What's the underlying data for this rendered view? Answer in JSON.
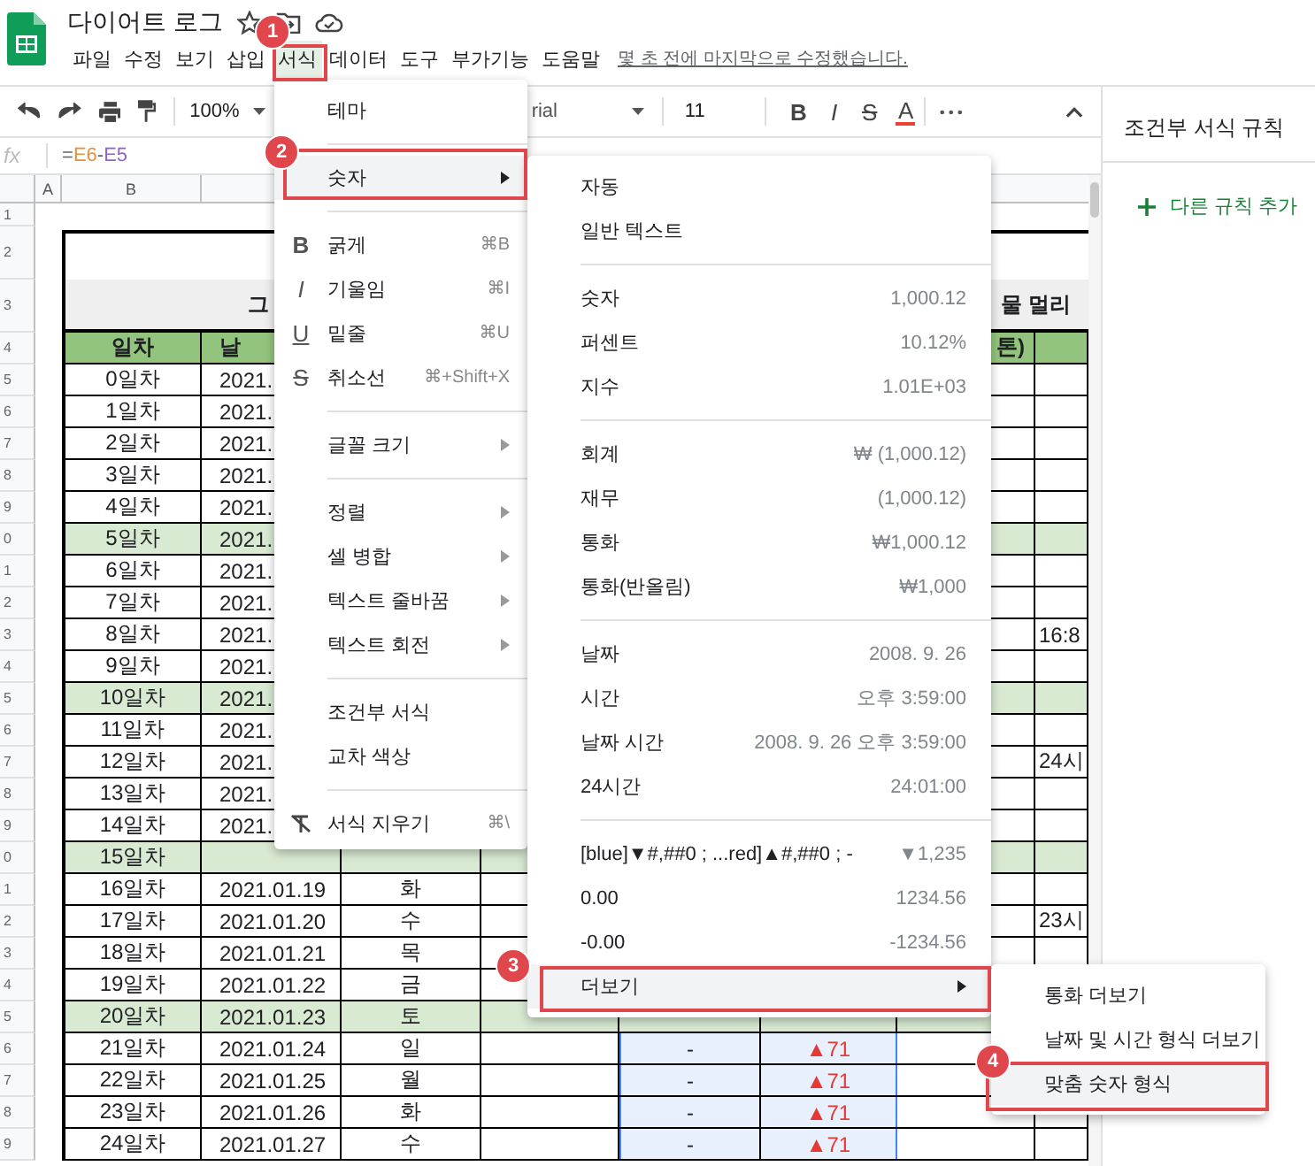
{
  "app": {
    "title": "다이어트 로그",
    "last_edit": "몇 초 전에 마지막으로 수정했습니다."
  },
  "menus": [
    {
      "label": "파일",
      "selected": false
    },
    {
      "label": "수정",
      "selected": false
    },
    {
      "label": "보기",
      "selected": false
    },
    {
      "label": "삽입",
      "selected": false
    },
    {
      "label": "서식",
      "selected": true
    },
    {
      "label": "데이터",
      "selected": false
    },
    {
      "label": "도구",
      "selected": false
    },
    {
      "label": "부가기능",
      "selected": false
    },
    {
      "label": "도움말",
      "selected": false
    }
  ],
  "toolbar": {
    "zoom": "100%",
    "font": "rial",
    "font_size": "11",
    "format_buttons": [
      {
        "glyph": "B",
        "kind": "bold"
      },
      {
        "glyph": "I",
        "kind": "italic"
      },
      {
        "glyph": "S",
        "kind": "strikethrough"
      },
      {
        "glyph": "A",
        "kind": "text-color"
      }
    ]
  },
  "formula_bar": {
    "fx": "fx",
    "parts": [
      {
        "text": "=",
        "color": "#5f6368"
      },
      {
        "text": "E6",
        "color": "#e69138"
      },
      {
        "text": "-",
        "color": "#5f6368"
      },
      {
        "text": "E5",
        "color": "#8e63ce"
      }
    ]
  },
  "columns": [
    "A",
    "B"
  ],
  "sheet": {
    "rows": [
      {
        "num": "1",
        "kind": "blank"
      },
      {
        "num": "2",
        "kind": "top"
      },
      {
        "num": "3",
        "kind": "title",
        "title_left": "그",
        "title_right": "물 멀리"
      },
      {
        "num": "4",
        "kind": "header",
        "day": "일차",
        "date": "날",
        "column_h": "톤)"
      },
      {
        "num": "5",
        "kind": "data",
        "highlighted": false,
        "day": "0일차",
        "date": "2021."
      },
      {
        "num": "6",
        "kind": "data",
        "highlighted": false,
        "day": "1일차",
        "date": "2021."
      },
      {
        "num": "7",
        "kind": "data",
        "highlighted": false,
        "day": "2일차",
        "date": "2021."
      },
      {
        "num": "8",
        "kind": "data",
        "highlighted": false,
        "day": "3일차",
        "date": "2021."
      },
      {
        "num": "9",
        "kind": "data",
        "highlighted": false,
        "day": "4일차",
        "date": "2021."
      },
      {
        "num": "0",
        "kind": "data",
        "highlighted": true,
        "day": "5일차",
        "date": "2021."
      },
      {
        "num": "1",
        "kind": "data",
        "highlighted": false,
        "day": "6일차",
        "date": "2021."
      },
      {
        "num": "2",
        "kind": "data",
        "highlighted": false,
        "day": "7일차",
        "date": "2021."
      },
      {
        "num": "3",
        "kind": "data",
        "highlighted": false,
        "day": "8일차",
        "date": "2021.",
        "column_i": "16:8"
      },
      {
        "num": "4",
        "kind": "data",
        "highlighted": false,
        "day": "9일차",
        "date": "2021."
      },
      {
        "num": "5",
        "kind": "data",
        "highlighted": true,
        "day": "10일차",
        "date": "2021."
      },
      {
        "num": "6",
        "kind": "data",
        "highlighted": false,
        "day": "11일차",
        "date": "2021."
      },
      {
        "num": "7",
        "kind": "data",
        "highlighted": false,
        "day": "12일차",
        "date": "2021.",
        "column_i": "24시"
      },
      {
        "num": "8",
        "kind": "data",
        "highlighted": false,
        "day": "13일차",
        "date": "2021."
      },
      {
        "num": "9",
        "kind": "data",
        "highlighted": false,
        "day": "14일차",
        "date": "2021."
      },
      {
        "num": "0",
        "kind": "data",
        "highlighted": true,
        "day": "15일차"
      },
      {
        "num": "1",
        "kind": "data",
        "highlighted": false,
        "day": "16일차",
        "date": "2021.01.19",
        "weekday": "화"
      },
      {
        "num": "2",
        "kind": "data",
        "highlighted": false,
        "day": "17일차",
        "date": "2021.01.20",
        "weekday": "수",
        "column_i": "23시"
      },
      {
        "num": "3",
        "kind": "data",
        "highlighted": false,
        "day": "18일차",
        "date": "2021.01.21",
        "weekday": "목"
      },
      {
        "num": "4",
        "kind": "data",
        "highlighted": false,
        "day": "19일차",
        "date": "2021.01.22",
        "weekday": "금"
      },
      {
        "num": "5",
        "kind": "data",
        "highlighted": true,
        "day": "20일차",
        "date": "2021.01.23",
        "weekday": "토"
      },
      {
        "num": "6",
        "kind": "data",
        "highlighted": false,
        "in_selection": true,
        "day": "21일차",
        "date": "2021.01.24",
        "weekday": "일",
        "column_f": "-",
        "column_g": "▲71"
      },
      {
        "num": "7",
        "kind": "data",
        "highlighted": false,
        "in_selection": true,
        "day": "22일차",
        "date": "2021.01.25",
        "weekday": "월",
        "column_f": "-",
        "column_g": "▲71"
      },
      {
        "num": "8",
        "kind": "data",
        "highlighted": false,
        "in_selection": true,
        "day": "23일차",
        "date": "2021.01.26",
        "weekday": "화",
        "column_f": "-",
        "column_g": "▲71"
      },
      {
        "num": "9",
        "kind": "data",
        "highlighted": false,
        "in_selection": true,
        "day": "24일차",
        "date": "2021.01.27",
        "weekday": "수",
        "column_f": "-",
        "column_g": "▲71"
      }
    ]
  },
  "format_menu": {
    "items": [
      {
        "kind": "item",
        "label": "테마",
        "selected": false
      },
      {
        "kind": "separator"
      },
      {
        "kind": "item",
        "label": "숫자",
        "submenu": true,
        "selected": true
      },
      {
        "kind": "separator"
      },
      {
        "kind": "bold",
        "label": "굵게",
        "glyph": "B",
        "shortcut": "⌘B",
        "selected": false
      },
      {
        "kind": "italic",
        "label": "기울임",
        "glyph": "I",
        "shortcut": "⌘I",
        "selected": false
      },
      {
        "kind": "underline",
        "label": "밑줄",
        "glyph": "U",
        "shortcut": "⌘U",
        "selected": false
      },
      {
        "kind": "strikethrough",
        "label": "취소선",
        "glyph": "S",
        "shortcut": "⌘+Shift+X",
        "selected": false
      },
      {
        "kind": "separator"
      },
      {
        "kind": "item",
        "label": "글꼴 크기",
        "submenu": true,
        "selected": false
      },
      {
        "kind": "separator"
      },
      {
        "kind": "item",
        "label": "정렬",
        "submenu": true,
        "selected": false
      },
      {
        "kind": "item",
        "label": "셀 병합",
        "submenu": true,
        "selected": false
      },
      {
        "kind": "item",
        "label": "텍스트 줄바꿈",
        "submenu": true,
        "selected": false
      },
      {
        "kind": "item",
        "label": "텍스트 회전",
        "submenu": true,
        "selected": false
      },
      {
        "kind": "separator"
      },
      {
        "kind": "item",
        "label": "조건부 서식",
        "selected": false
      },
      {
        "kind": "item",
        "label": "교차 색상",
        "selected": false
      },
      {
        "kind": "separator"
      },
      {
        "kind": "clear",
        "label": "서식 지우기",
        "shortcut": "⌘\\",
        "selected": false
      }
    ]
  },
  "number_menu": {
    "items": [
      {
        "kind": "item",
        "label": "자동",
        "selected": false
      },
      {
        "kind": "item",
        "label": "일반 텍스트",
        "selected": false
      },
      {
        "kind": "separator"
      },
      {
        "kind": "item",
        "label": "숫자",
        "example": "1,000.12",
        "selected": false
      },
      {
        "kind": "item",
        "label": "퍼센트",
        "example": "10.12%",
        "selected": false
      },
      {
        "kind": "item",
        "label": "지수",
        "example": "1.01E+03",
        "selected": false
      },
      {
        "kind": "separator"
      },
      {
        "kind": "item",
        "label": "회계",
        "example": "₩ (1,000.12)",
        "selected": false
      },
      {
        "kind": "item",
        "label": "재무",
        "example": "(1,000.12)",
        "selected": false
      },
      {
        "kind": "item",
        "label": "통화",
        "example": "₩1,000.12",
        "selected": false
      },
      {
        "kind": "item",
        "label": "통화(반올림)",
        "example": "₩1,000",
        "selected": false
      },
      {
        "kind": "separator"
      },
      {
        "kind": "item",
        "label": "날짜",
        "example": "2008. 9. 26",
        "selected": false
      },
      {
        "kind": "item",
        "label": "시간",
        "example": "오후 3:59:00",
        "selected": false
      },
      {
        "kind": "item",
        "label": "날짜 시간",
        "example": "2008. 9. 26 오후 3:59:00",
        "selected": false
      },
      {
        "kind": "item",
        "label": "24시간",
        "example": "24:01:00",
        "selected": false
      },
      {
        "kind": "separator"
      },
      {
        "kind": "item",
        "label": "[blue]▼#,##0 ; ...red]▲#,##0 ; -",
        "example": "▼1,235",
        "selected": false
      },
      {
        "kind": "item",
        "label": "0.00",
        "example": "1234.56",
        "selected": false
      },
      {
        "kind": "item",
        "label": "-0.00",
        "example": "-1234.56",
        "selected": false
      },
      {
        "kind": "item",
        "label": "더보기",
        "submenu": true,
        "selected": true
      }
    ]
  },
  "more_menu": {
    "items": [
      {
        "kind": "item",
        "label": "통화 더보기",
        "selected": false
      },
      {
        "kind": "item",
        "label": "날짜 및 시간 형식 더보기",
        "selected": false
      },
      {
        "kind": "item",
        "label": "맞춤 숫자 형식",
        "selected": true
      }
    ]
  },
  "side_panel": {
    "title": "조건부 서식 규칙",
    "add_rule": "다른 규칙 추가"
  },
  "annotations": [
    {
      "number": "1"
    },
    {
      "number": "2"
    },
    {
      "number": "3"
    },
    {
      "number": "4"
    }
  ]
}
